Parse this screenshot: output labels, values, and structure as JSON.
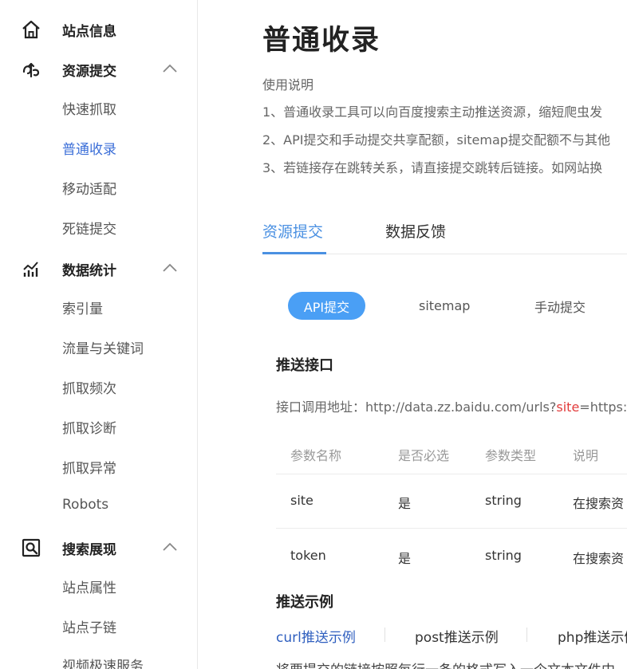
{
  "sidebar": {
    "groups": [
      {
        "label": "站点信息",
        "icon": "home-icon",
        "items": []
      },
      {
        "label": "资源提交",
        "icon": "submit-icon",
        "items": [
          "快速抓取",
          "普通收录",
          "移动适配",
          "死链提交"
        ]
      },
      {
        "label": "数据统计",
        "icon": "chart-icon",
        "items": [
          "索引量",
          "流量与关键词",
          "抓取频次",
          "抓取诊断",
          "抓取异常",
          "Robots"
        ]
      },
      {
        "label": "搜索展现",
        "icon": "search-display-icon",
        "items": [
          "站点属性",
          "站点子链",
          "视频极速服务"
        ]
      }
    ],
    "active_item": "普通收录"
  },
  "main": {
    "title": "普通收录",
    "usage": {
      "title": "使用说明",
      "lines": [
        "1、普通收录工具可以向百度搜索主动推送资源，缩短爬虫发",
        "2、API提交和手动提交共享配额，sitemap提交配额不与其他",
        "3、若链接存在跳转关系，请直接提交跳转后链接。如网站换"
      ]
    },
    "tabs": [
      "资源提交",
      "数据反馈"
    ],
    "methods": [
      "API提交",
      "sitemap",
      "手动提交"
    ],
    "push_api": {
      "title": "推送接口",
      "endpoint_label": "接口调用地址：",
      "endpoint_prefix": "http://data.zz.baidu.com/urls?",
      "endpoint_param": "site",
      "endpoint_suffix": "=https:"
    },
    "table": {
      "headers": [
        "参数名称",
        "是否必选",
        "参数类型",
        "说明"
      ],
      "rows": [
        [
          "site",
          "是",
          "string",
          "在搜索资"
        ],
        [
          "token",
          "是",
          "string",
          "在搜索资"
        ]
      ]
    },
    "examples": {
      "title": "推送示例",
      "tabs": [
        "curl推送示例",
        "post推送示例",
        "php推送示例"
      ],
      "footer": "将要提交的链接按照每行一条的格式写入一个文本文件中"
    }
  },
  "colors": {
    "accent": "#4a90e2",
    "pill": "#4a9ff5",
    "active_link": "#3c6fd8",
    "highlight": "#e23b3b"
  }
}
